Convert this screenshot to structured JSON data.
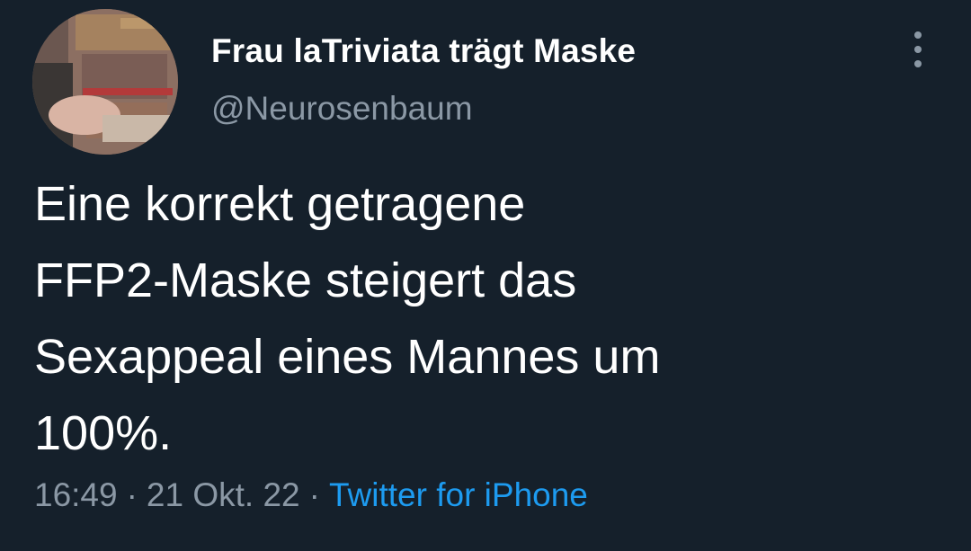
{
  "author": {
    "display_name": "Frau laTriviata trägt Maske",
    "handle": "@Neurosenbaum",
    "avatar_icon": "profile-photo"
  },
  "tweet": {
    "text_lines": [
      "Eine korrekt getragene",
      "FFP2-Maske steigert das",
      "Sexappeal eines Mannes um",
      "100%."
    ],
    "time": "16:49",
    "separator": "·",
    "date": "21 Okt. 22",
    "source": "Twitter for iPhone"
  },
  "menu": {
    "icon": "more-vertical-icon"
  },
  "colors": {
    "background": "#15202b",
    "primary_text": "#ffffff",
    "secondary_text": "#8b98a5",
    "accent": "#1d9bf0"
  }
}
